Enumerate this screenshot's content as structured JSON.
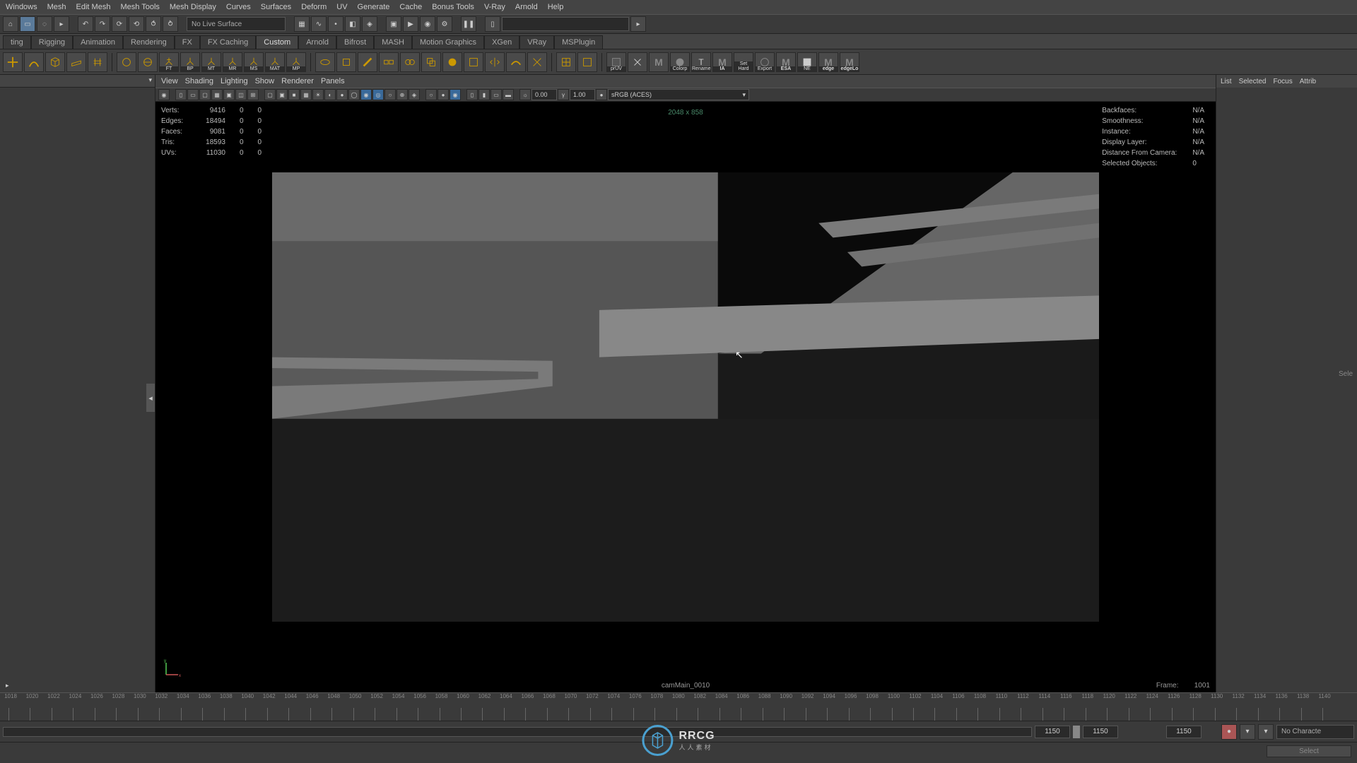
{
  "menubar": [
    "Windows",
    "Mesh",
    "Edit Mesh",
    "Mesh Tools",
    "Mesh Display",
    "Curves",
    "Surfaces",
    "Deform",
    "UV",
    "Generate",
    "Cache",
    "Bonus Tools",
    "V-Ray",
    "Arnold",
    "Help"
  ],
  "toolbar1": {
    "live_surface": "No Live Surface"
  },
  "tabs": [
    "ting",
    "Rigging",
    "Animation",
    "Rendering",
    "FX",
    "FX Caching",
    "Custom",
    "Arnold",
    "Bifrost",
    "MASH",
    "Motion Graphics",
    "XGen",
    "VRay",
    "MSPlugin"
  ],
  "shelf_labels": [
    "FT",
    "BP",
    "MT",
    "MR",
    "MS",
    "MAT",
    "MP",
    "prUV",
    "Colorp",
    "Rename",
    "IA",
    "Set Hard",
    "Export",
    "ESA",
    "NE",
    "edge",
    "edgeLo"
  ],
  "vp_menus": [
    "View",
    "Shading",
    "Lighting",
    "Show",
    "Renderer",
    "Panels"
  ],
  "vp_exposure": "0.00",
  "vp_gamma": "1.00",
  "vp_colorspace": "sRGB (ACES)",
  "hud_tl": {
    "rows": [
      {
        "label": "Verts:",
        "v1": "9416",
        "v2": "0",
        "v3": "0"
      },
      {
        "label": "Edges:",
        "v1": "18494",
        "v2": "0",
        "v3": "0"
      },
      {
        "label": "Faces:",
        "v1": "9081",
        "v2": "0",
        "v3": "0"
      },
      {
        "label": "Tris:",
        "v1": "18593",
        "v2": "0",
        "v3": "0"
      },
      {
        "label": "UVs:",
        "v1": "11030",
        "v2": "0",
        "v3": "0"
      }
    ]
  },
  "hud_tr": {
    "rows": [
      {
        "label": "Backfaces:",
        "val": "N/A"
      },
      {
        "label": "Smoothness:",
        "val": "N/A"
      },
      {
        "label": "Instance:",
        "val": "N/A"
      },
      {
        "label": "Display Layer:",
        "val": "N/A"
      },
      {
        "label": "Distance From Camera:",
        "val": "N/A"
      },
      {
        "label": "Selected Objects:",
        "val": "0"
      }
    ]
  },
  "hud_res": "2048 x 858",
  "hud_cam": "camMain_0010",
  "hud_frame_label": "Frame:",
  "hud_frame_val": "1001",
  "rightpanel_tabs": [
    "List",
    "Selected",
    "Focus",
    "Attrib"
  ],
  "rightpanel_body": "Sele",
  "timeline": {
    "start": 1018,
    "end": 1140,
    "step": 2
  },
  "range": {
    "f1": "1150",
    "f2": "1150",
    "f3": "1150",
    "anim": "No Characte"
  },
  "select_label": "Select",
  "watermark": {
    "brand": "RRCG",
    "sub": "人人素材"
  }
}
